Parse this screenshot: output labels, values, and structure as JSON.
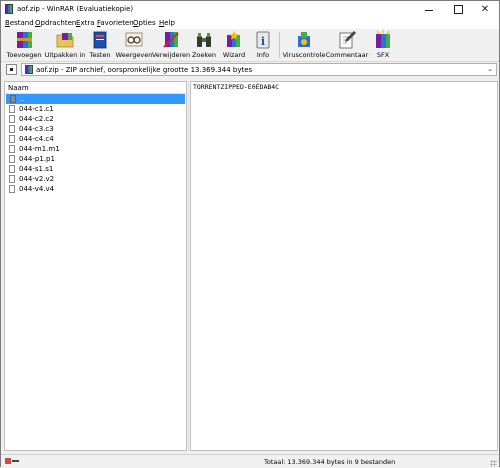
{
  "window": {
    "title": "aof.zip - WinRAR (Evaluatiekopie)"
  },
  "menu": [
    {
      "label": "Bestand",
      "accel": "B"
    },
    {
      "label": "Opdrachten",
      "accel": "O"
    },
    {
      "label": "Extra",
      "accel": "E"
    },
    {
      "label": "Favorieten",
      "accel": "F"
    },
    {
      "label": "Opties",
      "accel": "O"
    },
    {
      "label": "Help",
      "accel": "H"
    }
  ],
  "toolbar": {
    "add": "Toevoegen",
    "extract": "Uitpakken in",
    "test": "Testen",
    "view": "Weergeven",
    "delete": "Verwijderen",
    "find": "Zoeken",
    "wizard": "Wizard",
    "info": "Info",
    "virus": "Viruscontrole",
    "comment": "Commentaar",
    "sfx": "SFX"
  },
  "address": {
    "text": "aof.zip - ZIP archief, oorspronkelijke grootte 13.369.344 bytes"
  },
  "file_list": {
    "column_name": "Naam",
    "items": [
      "..",
      "044-c1.c1",
      "044-c2.c2",
      "044-c3.c3",
      "044-c4.c4",
      "044-m1.m1",
      "044-p1.p1",
      "044-s1.s1",
      "044-v2.v2",
      "044-v4.v4"
    ]
  },
  "comment": {
    "text": "TORRENTZIPPED-E0ÉDAB4C"
  },
  "status": {
    "text": "Totaal: 13.369.344 bytes in 9 bestanden"
  },
  "colors": {
    "selection": "#3399ff",
    "window_bg": "#f0f0f0"
  }
}
